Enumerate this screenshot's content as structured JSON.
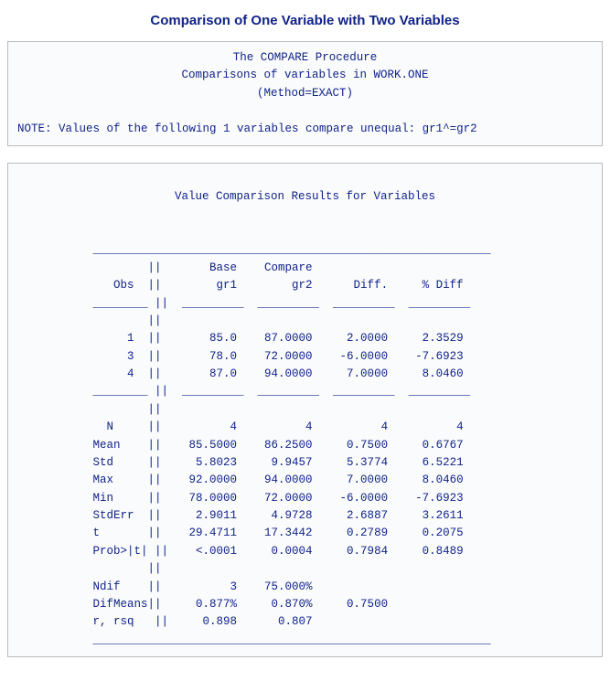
{
  "title": "Comparison of One Variable with Two Variables",
  "block1": {
    "line1": "The COMPARE Procedure",
    "line2": "Comparisons of variables in WORK.ONE",
    "line3": "(Method=EXACT)",
    "note": "NOTE: Values of the following 1 variables compare unequal: gr1^=gr2"
  },
  "block2": {
    "heading": "Value Comparison Results for Variables",
    "hr_top": "           __________________________________________________________",
    "hdr1": "                   ||       Base    Compare",
    "hdr2": "              Obs  ||        gr1        gr2      Diff.     % Diff",
    "hdr_rule": "           ________ ||  _________  _________  _________  _________",
    "blank_sep": "                   ||",
    "r1": "                1  ||       85.0    87.0000     2.0000     2.3529",
    "r2": "                3  ||       78.0    72.0000    -6.0000    -7.6923",
    "r3": "                4  ||       87.0    94.0000     7.0000     8.0460",
    "s_N": "             N     ||          4          4          4          4",
    "s_Mean": "           Mean    ||    85.5000    86.2500     0.7500     0.6767",
    "s_Std": "           Std     ||     5.8023     9.9457     5.3774     6.5221",
    "s_Max": "           Max     ||    92.0000    94.0000     7.0000     8.0460",
    "s_Min": "           Min     ||    78.0000    72.0000    -6.0000    -7.6923",
    "s_StdErr": "           StdErr  ||     2.9011     4.9728     2.6887     3.2611",
    "s_t": "           t       ||    29.4711    17.3442     0.2789     0.2075",
    "s_Prob": "           Prob>|t| ||    <.0001     0.0004     0.7984     0.8489",
    "s_Ndif": "           Ndif    ||          3    75.000%",
    "s_DifMeans": "           DifMeans||     0.877%     0.870%     0.7500",
    "s_rrsq": "           r, rsq   ||     0.898      0.807",
    "hr_bot": "           __________________________________________________________"
  },
  "chart_data": {
    "type": "table",
    "title": "Value Comparison Results for Variables",
    "base_var": "gr1",
    "compare_var": "gr2",
    "dataset": "WORK.ONE",
    "method": "EXACT",
    "observations": [
      {
        "Obs": 1,
        "gr1": 85.0,
        "gr2": 87.0,
        "Diff": 2.0,
        "PctDiff": 2.3529
      },
      {
        "Obs": 3,
        "gr1": 78.0,
        "gr2": 72.0,
        "Diff": -6.0,
        "PctDiff": -7.6923
      },
      {
        "Obs": 4,
        "gr1": 87.0,
        "gr2": 94.0,
        "Diff": 7.0,
        "PctDiff": 8.046
      }
    ],
    "summary": {
      "N": {
        "gr1": 4,
        "gr2": 4,
        "Diff": 4,
        "PctDiff": 4
      },
      "Mean": {
        "gr1": 85.5,
        "gr2": 86.25,
        "Diff": 0.75,
        "PctDiff": 0.6767
      },
      "Std": {
        "gr1": 5.8023,
        "gr2": 9.9457,
        "Diff": 5.3774,
        "PctDiff": 6.5221
      },
      "Max": {
        "gr1": 92.0,
        "gr2": 94.0,
        "Diff": 7.0,
        "PctDiff": 8.046
      },
      "Min": {
        "gr1": 78.0,
        "gr2": 72.0,
        "Diff": -6.0,
        "PctDiff": -7.6923
      },
      "StdErr": {
        "gr1": 2.9011,
        "gr2": 4.9728,
        "Diff": 2.6887,
        "PctDiff": 3.2611
      },
      "t": {
        "gr1": 29.4711,
        "gr2": 17.3442,
        "Diff": 0.2789,
        "PctDiff": 0.2075
      },
      "Prob>|t|": {
        "gr1": "<.0001",
        "gr2": 0.0004,
        "Diff": 0.7984,
        "PctDiff": 0.8489
      },
      "Ndif": {
        "gr1": 3,
        "gr2": "75.000%"
      },
      "DifMeans": {
        "gr1": "0.877%",
        "gr2": "0.870%",
        "Diff": 0.75
      },
      "r, rsq": {
        "gr1": 0.898,
        "gr2": 0.807
      }
    }
  }
}
